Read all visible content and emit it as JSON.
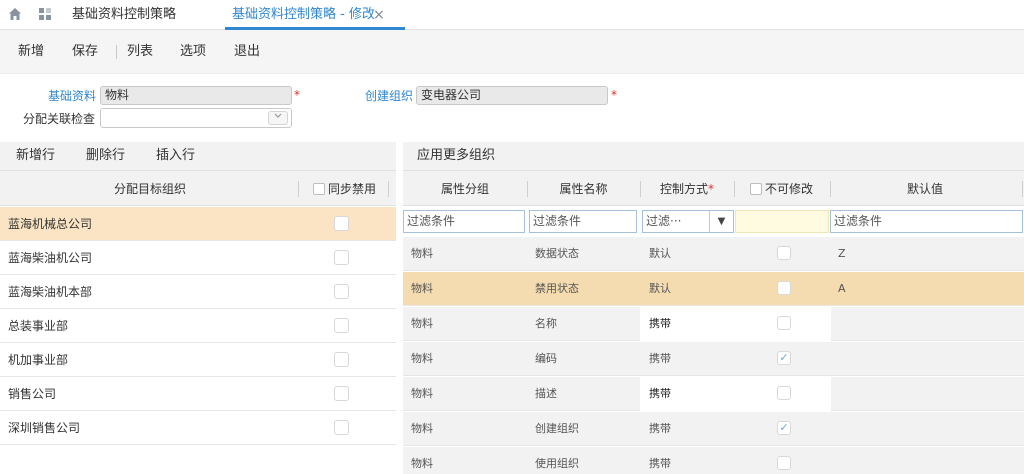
{
  "tabs": {
    "home_icon": "home-icon",
    "apps_icon": "apps-icon",
    "items": [
      {
        "label": "基础资料控制策略"
      },
      {
        "label": "基础资料控制策略 - 修改"
      }
    ],
    "close_icon": "×"
  },
  "toolbar": {
    "buttons": [
      "新增",
      "保存",
      "列表",
      "选项",
      "退出"
    ]
  },
  "form": {
    "basic_data_label": "基础资料",
    "basic_data_value": "物料",
    "create_org_label": "创建组织",
    "create_org_value": "变电器公司",
    "relation_check_label": "分配关联检查",
    "relation_check_value": "",
    "required_mark": "*"
  },
  "left_panel": {
    "buttons": [
      "新增行",
      "删除行",
      "插入行"
    ],
    "col_target_org": "分配目标组织",
    "col_sync_disable": "同步禁用",
    "rows": [
      {
        "name": "蓝海机械总公司",
        "selected": true
      },
      {
        "name": "蓝海柴油机公司",
        "selected": false
      },
      {
        "name": "蓝海柴油机本部",
        "selected": false
      },
      {
        "name": "总装事业部",
        "selected": false
      },
      {
        "name": "机加事业部",
        "selected": false
      },
      {
        "name": "销售公司",
        "selected": false
      },
      {
        "name": "深圳销售公司",
        "selected": false
      }
    ]
  },
  "right_panel": {
    "button": "应用更多组织",
    "columns": {
      "group": "属性分组",
      "name": "属性名称",
      "control": "控制方式",
      "control_required": "*",
      "readonly": "不可修改",
      "default": "默认值"
    },
    "filter_placeholder": "过滤条件",
    "filter_select": "过滤···",
    "dropdown_icon": "▼",
    "rows": [
      {
        "group": "物料",
        "name": "数据状态",
        "control": "默认",
        "checked": false,
        "default": "Z",
        "selected": false,
        "white_control": false
      },
      {
        "group": "物料",
        "name": "禁用状态",
        "control": "默认",
        "checked": false,
        "default": "A",
        "selected": true,
        "white_control": false
      },
      {
        "group": "物料",
        "name": "名称",
        "control": "携带",
        "checked": false,
        "default": "",
        "selected": false,
        "white_control": true
      },
      {
        "group": "物料",
        "name": "编码",
        "control": "携带",
        "checked": true,
        "default": "",
        "selected": false,
        "white_control": false
      },
      {
        "group": "物料",
        "name": "描述",
        "control": "携带",
        "checked": false,
        "default": "",
        "selected": false,
        "white_control": true
      },
      {
        "group": "物料",
        "name": "创建组织",
        "control": "携带",
        "checked": true,
        "default": "",
        "selected": false,
        "white_control": false
      },
      {
        "group": "物料",
        "name": "使用组织",
        "control": "携带",
        "checked": false,
        "default": "",
        "selected": false,
        "white_control": false
      }
    ],
    "check_mark": "✓"
  }
}
